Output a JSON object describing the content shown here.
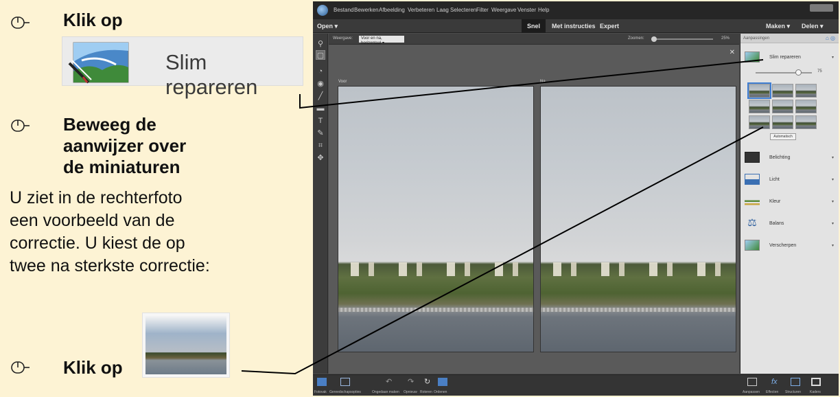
{
  "instructions": {
    "step1": "Klik op",
    "smart_label": "Slim repareren",
    "step2": "Beweeg de aanwijzer over de miniaturen",
    "body": "U ziet in de rechterfoto een voorbeeld van de correctie. U kiest de op twee na sterkste correctie:",
    "step3": "Klik op"
  },
  "app": {
    "menu": [
      "Bestand",
      "Bewerken",
      "Afbeelding",
      "Verbeteren",
      "Laag",
      "Selecteren",
      "Filter",
      "Weergave",
      "Venster",
      "Help"
    ],
    "mode_open": "Open",
    "modes": [
      "Snel",
      "Met instructies",
      "Expert"
    ],
    "active_mode": "Snel",
    "make": "Maken",
    "share": "Delen",
    "view_label": "Weergave:",
    "view_value": "Voor en na, horizontaal",
    "zoom_label": "Zoomen:",
    "zoom_value": "25%",
    "photo_before": "Voor",
    "photo_after": "Na",
    "panel_title": "Aanpassingen",
    "smart_fix": "Slim repareren",
    "smart_value": "75",
    "auto_button": "Automatisch",
    "adjustments": [
      "Belichting",
      "Licht",
      "Kleur",
      "Balans",
      "Verscherpen"
    ],
    "bottom_left": [
      "Fotovak",
      "Gereedschapsopties",
      "Ongedaan maken",
      "Opnieuw",
      "Roteren",
      "Ordenen"
    ],
    "bottom_right": [
      "Aanpassen",
      "Effecten",
      "Structuren",
      "Kaders"
    ]
  }
}
